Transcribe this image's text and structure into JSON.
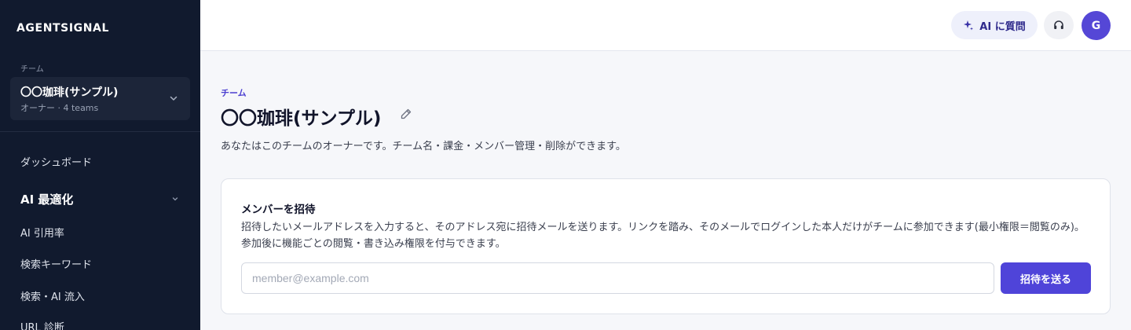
{
  "sidebar": {
    "brand": "AGENTSIGNAL",
    "team_caption": "チーム",
    "team_name": "〇〇珈琲(サンプル)",
    "team_meta": "オーナー · 4 teams",
    "nav": {
      "dashboard": "ダッシュボード",
      "group_ai": "AI 最適化",
      "ai_citation": "AI 引用率",
      "search_keywords": "検索キーワード",
      "search_ai_inflow": "検索・AI 流入",
      "url_diagnosis": "URL 診断"
    },
    "icons": {
      "team_chevron": "chevron-down-icon",
      "group_chevron": "chevron-down-icon"
    }
  },
  "topbar": {
    "ai_button_label": "AI に質問",
    "ai_icon": "sparkle-icon",
    "support_icon": "headset-icon",
    "avatar_initial": "G"
  },
  "main": {
    "eyebrow": "チーム",
    "title": "〇〇珈琲(サンプル)",
    "edit_icon": "pencil-icon",
    "description": "あなたはこのチームのオーナーです。チーム名・課金・メンバー管理・削除ができます。",
    "invite_card": {
      "title": "メンバーを招待",
      "description": "招待したいメールアドレスを入力すると、そのアドレス宛に招待メールを送ります。リンクを踏み、そのメールでログインした本人だけがチームに参加できます(最小権限＝閲覧のみ)。参加後に機能ごとの閲覧・書き込み権限を付与できます。",
      "input_placeholder": "member@example.com",
      "input_value": "",
      "submit_label": "招待を送る"
    }
  },
  "colors": {
    "sidebar_bg": "#111a2e",
    "accent": "#4f44d9",
    "eyebrow": "#4b3fd0",
    "page_bg": "#f6f7fa"
  }
}
